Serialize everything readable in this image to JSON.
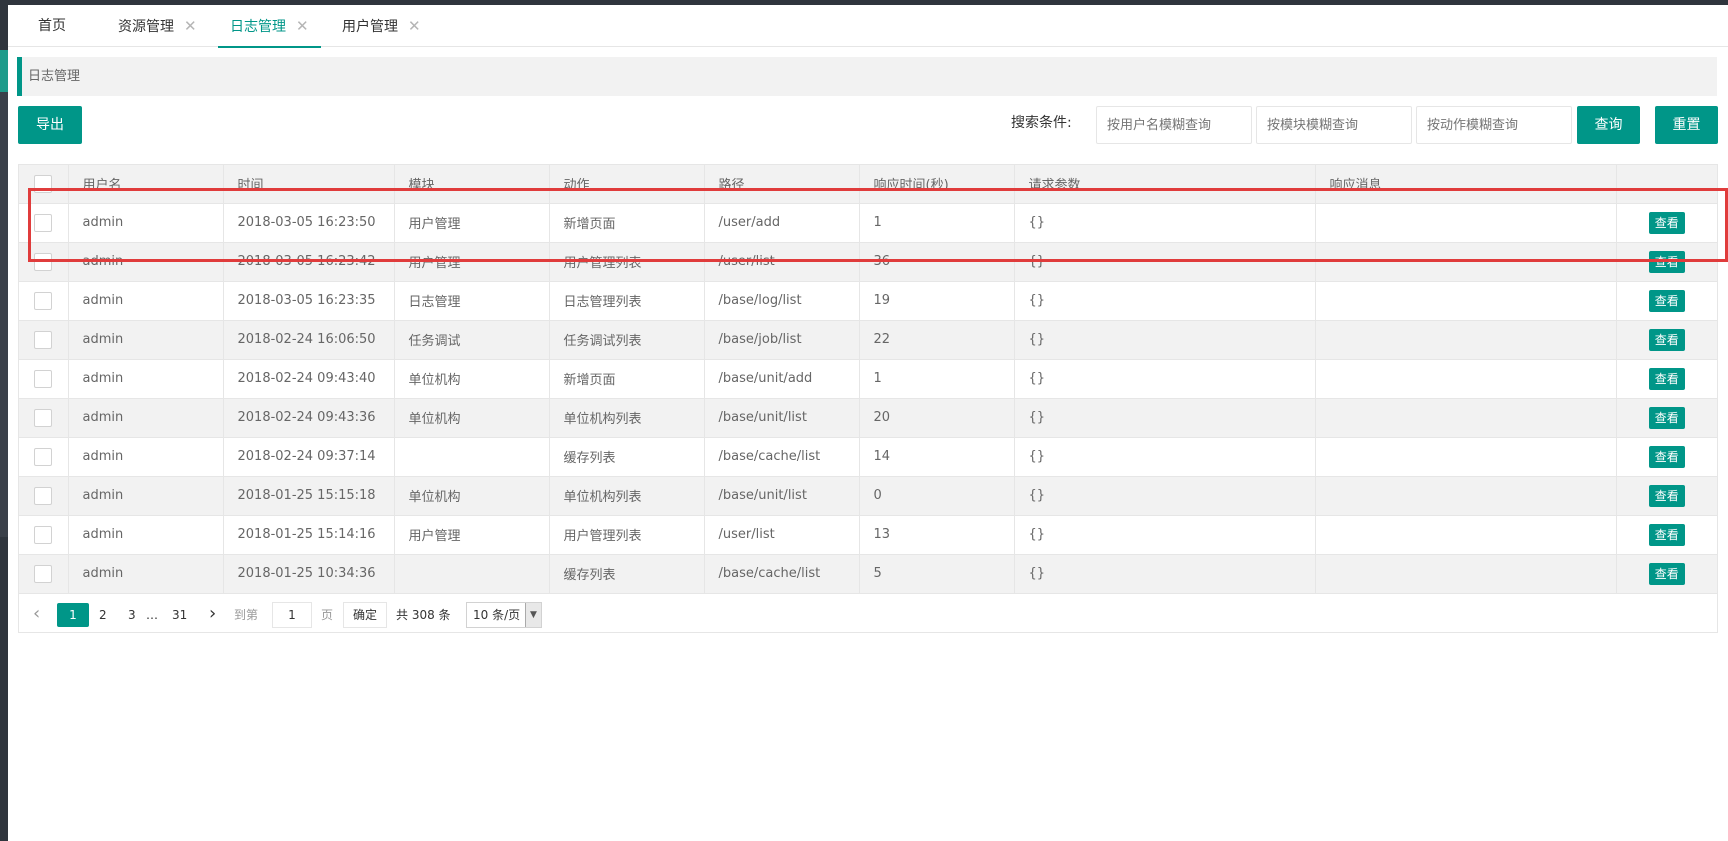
{
  "tabs": [
    {
      "label": "首页",
      "closable": false,
      "active": false
    },
    {
      "label": "资源管理",
      "closable": true,
      "active": false
    },
    {
      "label": "日志管理",
      "closable": true,
      "active": true
    },
    {
      "label": "用户管理",
      "closable": true,
      "active": false
    }
  ],
  "tab_close_glyph": "✕",
  "breadcrumb": "日志管理",
  "toolbar": {
    "export_label": "导出",
    "search_label": "搜索条件:",
    "username_placeholder": "按用户名模糊查询",
    "module_placeholder": "按模块模糊查询",
    "action_placeholder": "按动作模糊查询",
    "query_label": "查询",
    "reset_label": "重置"
  },
  "table": {
    "headers": [
      "用户名",
      "时间",
      "模块",
      "动作",
      "路径",
      "响应时间(秒)",
      "请求参数",
      "响应消息",
      ""
    ],
    "view_label": "查看",
    "rows": [
      [
        "admin",
        "2018-03-05 16:23:50",
        "用户管理",
        "新增页面",
        "/user/add",
        "1",
        "{}",
        ""
      ],
      [
        "admin",
        "2018-03-05 16:23:42",
        "用户管理",
        "用户管理列表",
        "/user/list",
        "36",
        "{}",
        ""
      ],
      [
        "admin",
        "2018-03-05 16:23:35",
        "日志管理",
        "日志管理列表",
        "/base/log/list",
        "19",
        "{}",
        ""
      ],
      [
        "admin",
        "2018-02-24 16:06:50",
        "任务调试",
        "任务调试列表",
        "/base/job/list",
        "22",
        "{}",
        ""
      ],
      [
        "admin",
        "2018-02-24 09:43:40",
        "单位机构",
        "新增页面",
        "/base/unit/add",
        "1",
        "{}",
        ""
      ],
      [
        "admin",
        "2018-02-24 09:43:36",
        "单位机构",
        "单位机构列表",
        "/base/unit/list",
        "20",
        "{}",
        ""
      ],
      [
        "admin",
        "2018-02-24 09:37:14",
        "",
        "缓存列表",
        "/base/cache/list",
        "14",
        "{}",
        ""
      ],
      [
        "admin",
        "2018-01-25 15:15:18",
        "单位机构",
        "单位机构列表",
        "/base/unit/list",
        "0",
        "{}",
        ""
      ],
      [
        "admin",
        "2018-01-25 15:14:16",
        "用户管理",
        "用户管理列表",
        "/user/list",
        "13",
        "{}",
        ""
      ],
      [
        "admin",
        "2018-01-25 10:34:36",
        "",
        "缓存列表",
        "/base/cache/list",
        "5",
        "{}",
        ""
      ]
    ]
  },
  "pagination": {
    "prev": "‹",
    "pages": [
      "1",
      "2",
      "3"
    ],
    "ellipsis": "…",
    "last_page": "31",
    "next": "›",
    "goto_label": "到第",
    "goto_value": "1",
    "page_unit": "页",
    "confirm_label": "确定",
    "total_label": "共 308 条",
    "page_size": "10 条/页",
    "current_page": "1"
  },
  "colors": {
    "accent": "#009688",
    "highlight": "#e03c3c",
    "frame": "#2f353d"
  }
}
